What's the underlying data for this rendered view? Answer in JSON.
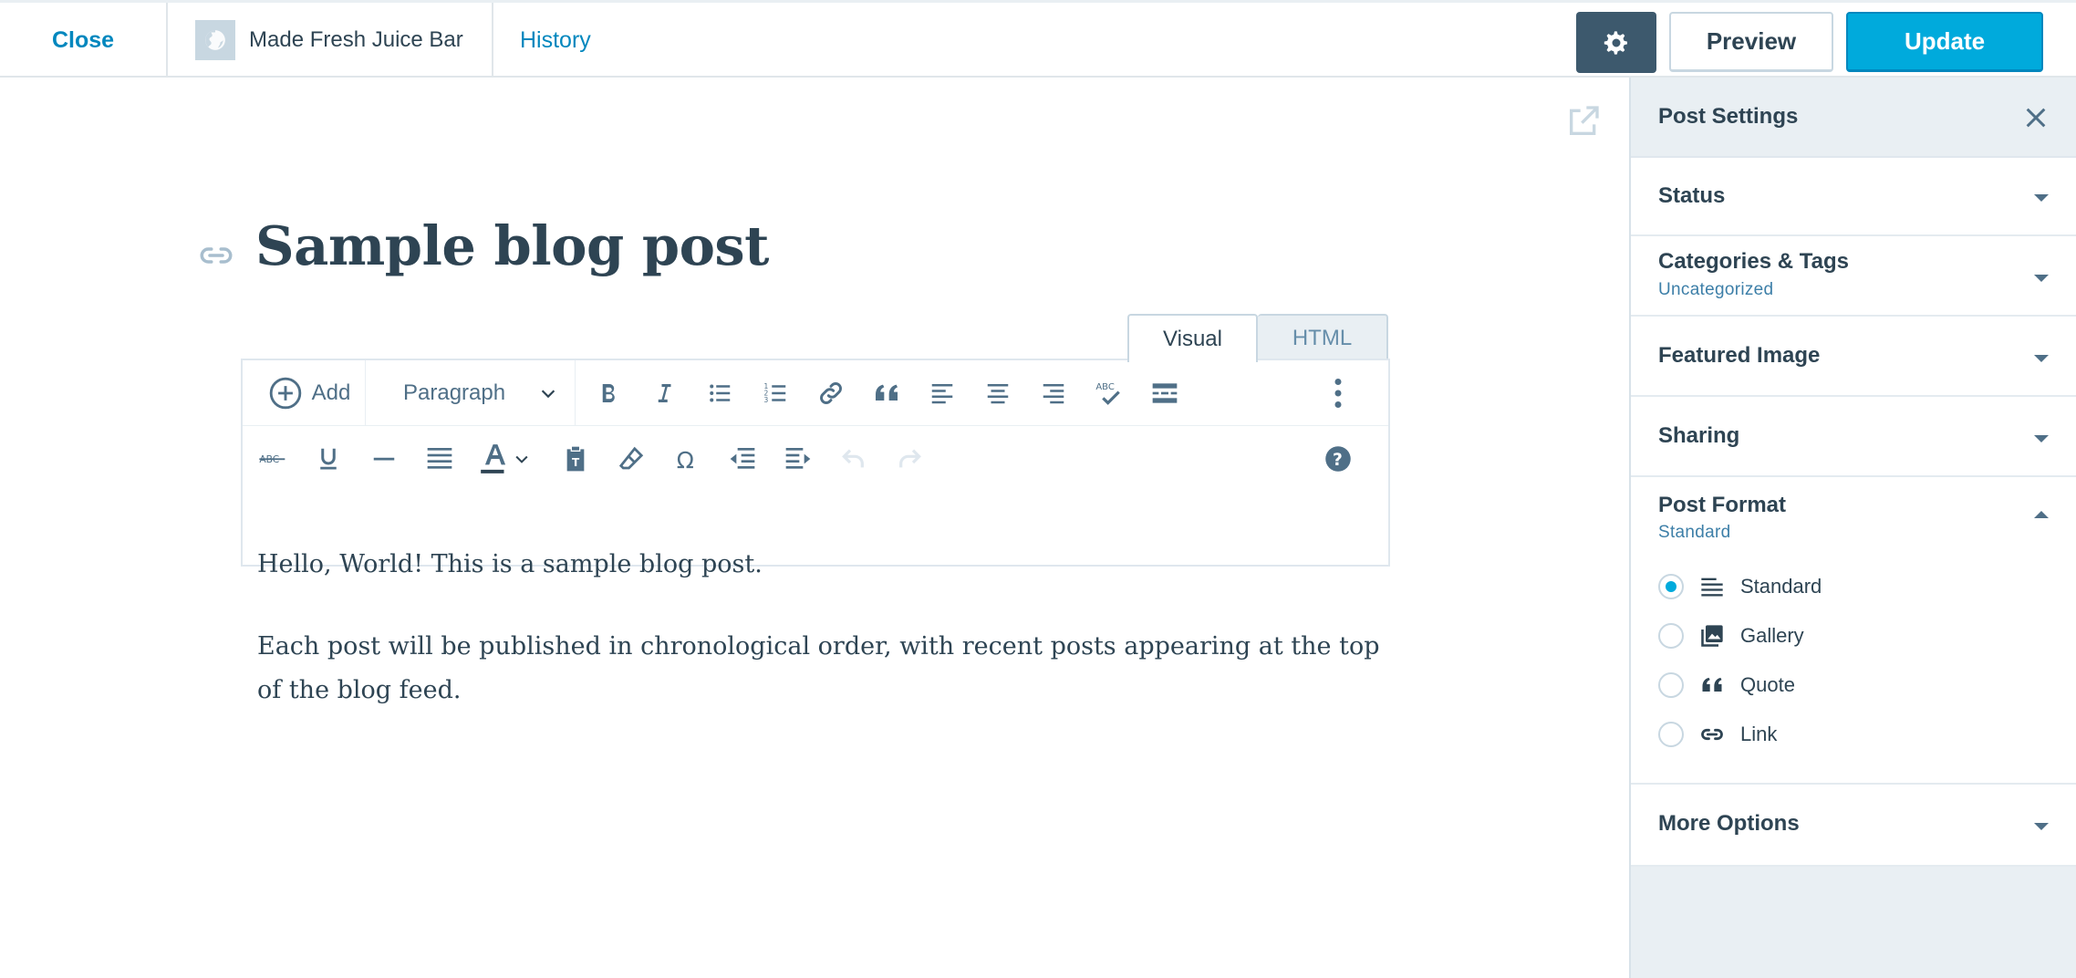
{
  "topbar": {
    "close_label": "Close",
    "site_name": "Made Fresh Juice Bar",
    "history_label": "History",
    "settings_icon": "gear-icon",
    "preview_label": "Preview",
    "update_label": "Update"
  },
  "editor": {
    "title": "Sample blog post",
    "tabs": {
      "visual": "Visual",
      "html": "HTML"
    },
    "toolbar": {
      "add_label": "Add",
      "format_selected": "Paragraph",
      "row1_icons": [
        "bold-icon",
        "italic-icon",
        "bulleted-list-icon",
        "numbered-list-icon",
        "link-icon",
        "blockquote-icon",
        "align-left-icon",
        "align-center-icon",
        "align-right-icon",
        "spellcheck-icon",
        "more-tag-icon",
        "ellipsis-icon"
      ],
      "row2_icons": [
        "strikethrough-icon",
        "underline-icon",
        "horizontal-rule-icon",
        "justify-icon",
        "text-color-icon",
        "paste-text-icon",
        "clear-formatting-icon",
        "special-character-icon",
        "outdent-icon",
        "indent-icon",
        "undo-icon",
        "redo-icon",
        "help-icon"
      ]
    },
    "paragraphs": [
      "Hello, World! This is a sample blog post.",
      "Each post will be published in chronological order, with recent posts appearing at the top of the blog feed."
    ]
  },
  "sidebar": {
    "header": "Post Settings",
    "sections": {
      "status": {
        "title": "Status"
      },
      "categories": {
        "title": "Categories & Tags",
        "subtitle": "Uncategorized"
      },
      "featured": {
        "title": "Featured Image"
      },
      "sharing": {
        "title": "Sharing"
      },
      "post_format": {
        "title": "Post Format",
        "subtitle": "Standard",
        "options": [
          {
            "label": "Standard",
            "icon": "standard-format-icon",
            "checked": true
          },
          {
            "label": "Gallery",
            "icon": "gallery-icon",
            "checked": false
          },
          {
            "label": "Quote",
            "icon": "quote-icon",
            "checked": false
          },
          {
            "label": "Link",
            "icon": "link-icon",
            "checked": false
          }
        ]
      },
      "more": {
        "title": "More Options"
      }
    }
  },
  "colors": {
    "accent": "#00aadc",
    "link": "#0087be",
    "text": "#2e4453",
    "icon": "#4f6f87",
    "sidebar_bg": "#e9eff3"
  }
}
